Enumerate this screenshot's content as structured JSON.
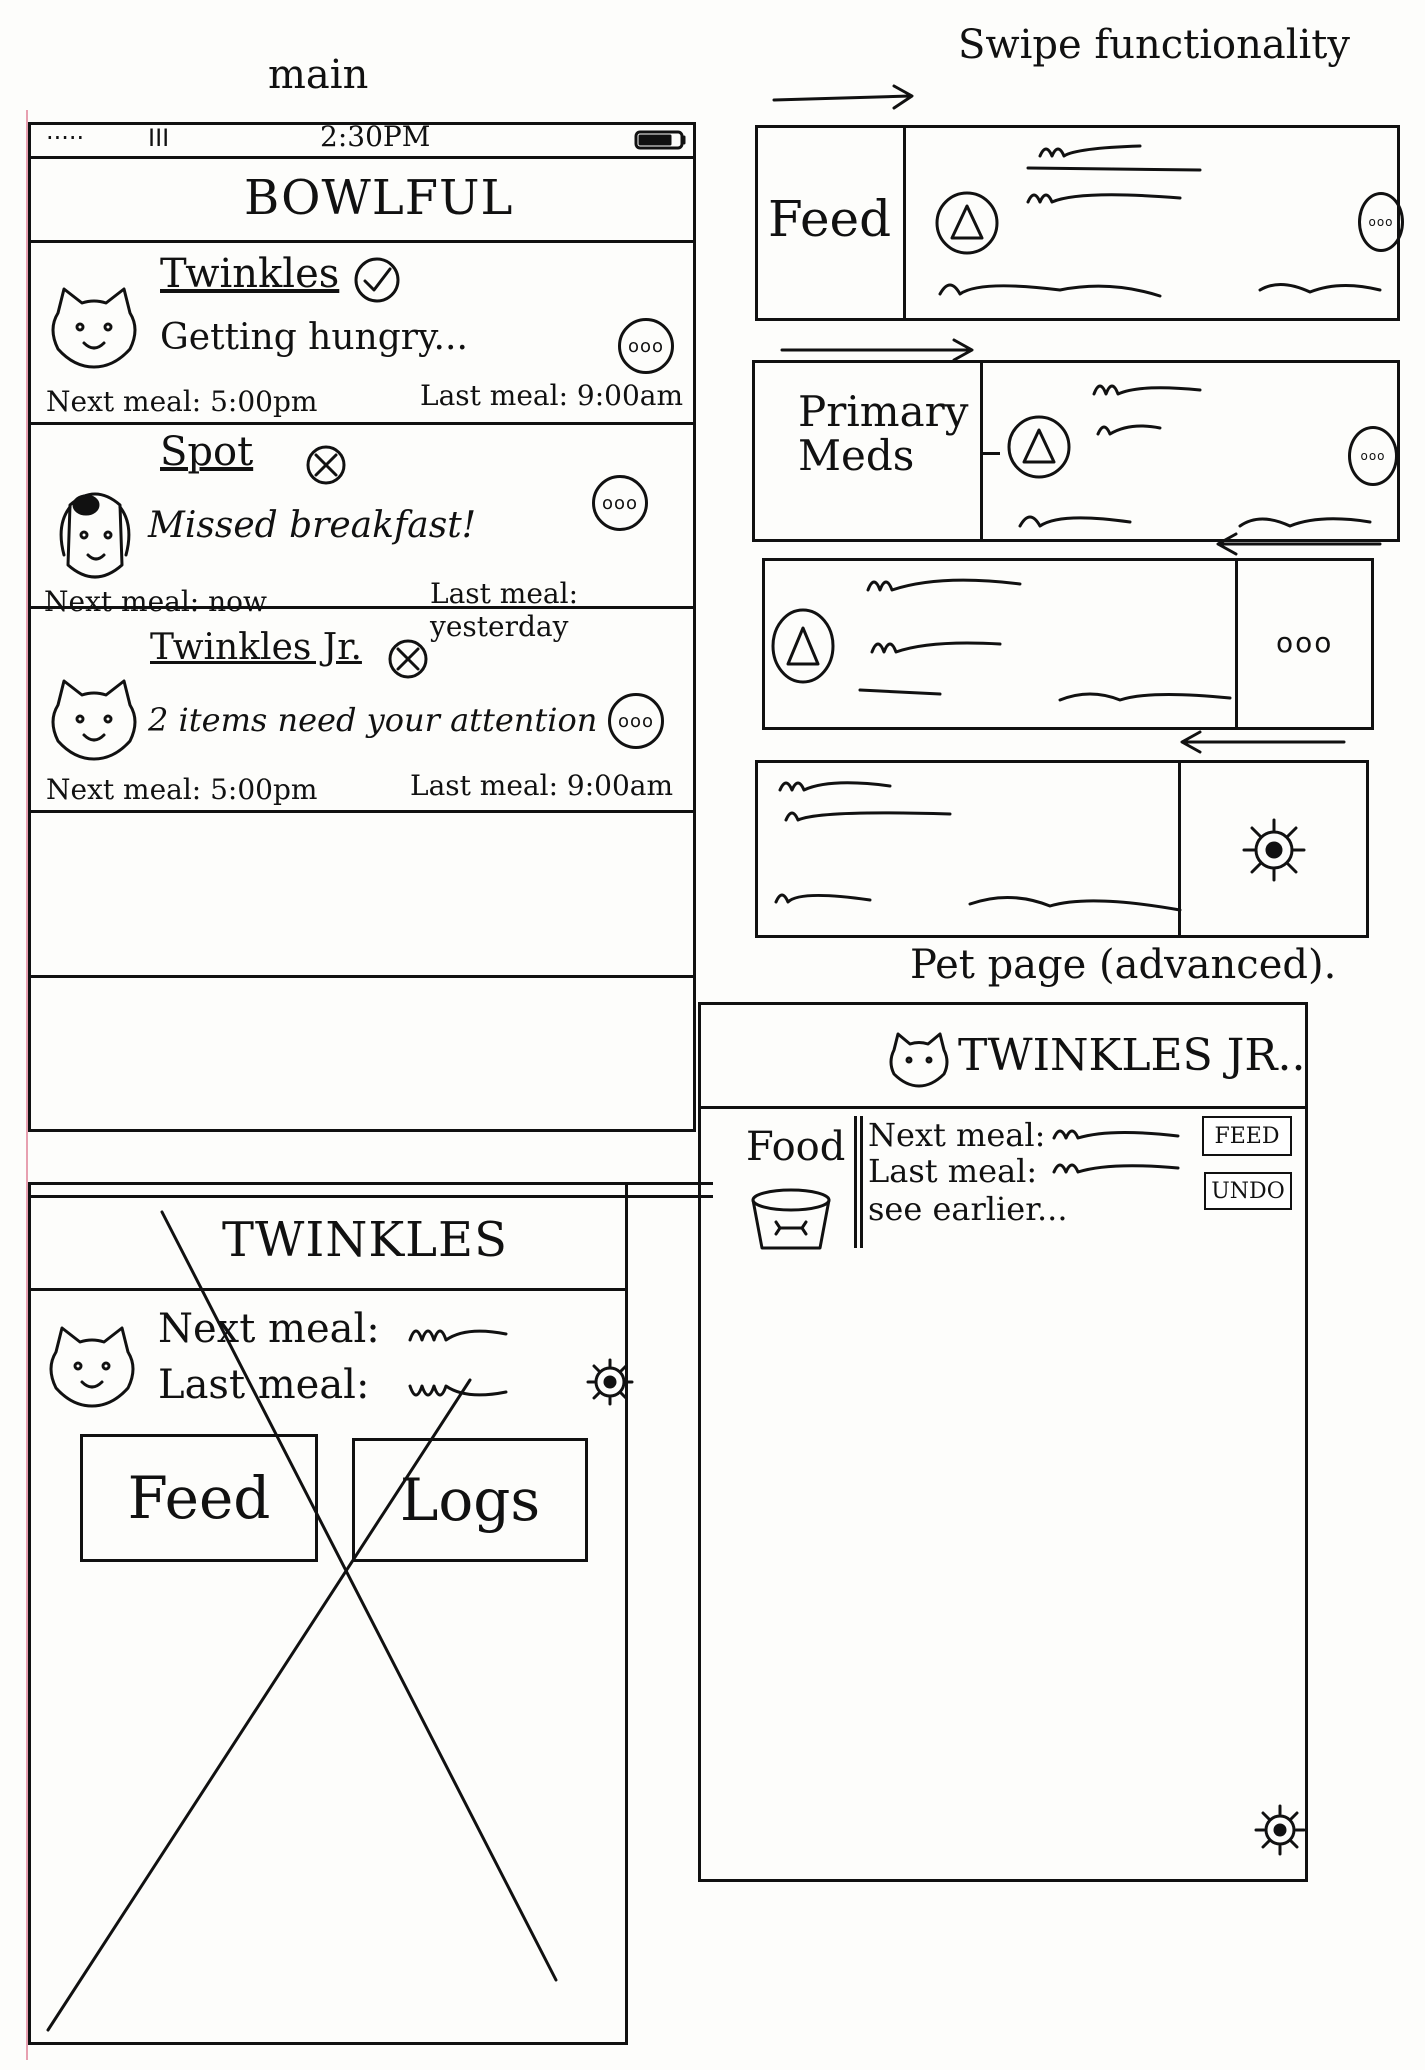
{
  "labels": {
    "main": "main",
    "swipe": "Swipe functionality",
    "pet_page": "Pet page (advanced)."
  },
  "status_bar": {
    "signal": "·····",
    "bars": "III",
    "time": "2:30PM"
  },
  "app": {
    "title": "BOWLFUL",
    "pets": [
      {
        "name": "Twinkles",
        "status_mark": "check",
        "message": "Getting hungry...",
        "more": "ooo",
        "next_meal": "Next meal: 5:00pm",
        "last_meal": "Last meal: 9:00am"
      },
      {
        "name": "Spot",
        "status_mark": "cross",
        "message": "Missed breakfast!",
        "more": "ooo",
        "next_meal": "Next meal: now",
        "last_meal": "Last meal: yesterday"
      },
      {
        "name": "Twinkles Jr.",
        "status_mark": "cross",
        "message": "2 items need your attention",
        "more": "ooo",
        "next_meal": "Next meal: 5:00pm",
        "last_meal": "Last meal: 9:00am"
      }
    ]
  },
  "detail": {
    "title": "TWINKLES",
    "next_meal": "Next meal:",
    "last_meal": "Last meal:",
    "feed_button": "Feed",
    "logs_button": "Logs",
    "settings_icon": "gear-icon"
  },
  "swipe": {
    "feed_action": "Feed",
    "meds_action": "Primary Meds",
    "more_action": "ooo",
    "settings_icon": "gear-icon"
  },
  "pet_page": {
    "title": "TWINKLES JR..",
    "section": "Food",
    "next_meal": "Next meal:",
    "last_meal": "Last meal:",
    "see_earlier": "see earlier...",
    "feed_button": "FEED",
    "undo_button": "UNDO",
    "settings_icon": "gear-icon"
  }
}
